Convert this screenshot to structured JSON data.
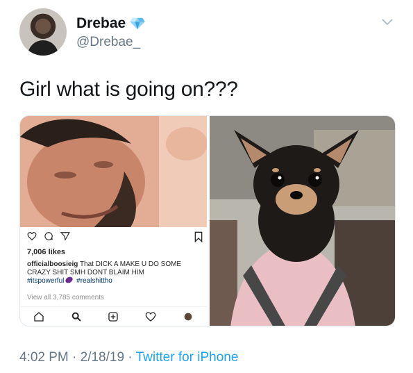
{
  "tweet": {
    "display_name": "Drebae",
    "handle": "@Drebae_",
    "text": "Girl what is going on???",
    "verified_icon": "verified-diamond-icon",
    "menu_icon": "chevron-down-icon",
    "timestamp": "4:02 PM · 2/18/19 ·",
    "source": "Twitter for iPhone"
  },
  "instagram_post": {
    "likes": "7,006 likes",
    "username": "officialboosieig",
    "caption": "That DICK A MAKE U DO SOME CRAZY SHIT SMH DONT BLAIM HIM",
    "hashtag_1": "#itspowerful",
    "hashtag_2": "#realshittho",
    "view_comments": "View all 3,785 comments",
    "action_icons": [
      "heart-icon",
      "comment-icon",
      "send-icon",
      "bookmark-icon"
    ],
    "nav_icons": [
      "home-icon",
      "search-icon",
      "add-icon",
      "activity-heart-icon",
      "profile-icon"
    ]
  },
  "colors": {
    "verified": "#1da1f2",
    "link": "#1da1f2",
    "secondary_text": "#657786",
    "hashtag": "#003569"
  }
}
